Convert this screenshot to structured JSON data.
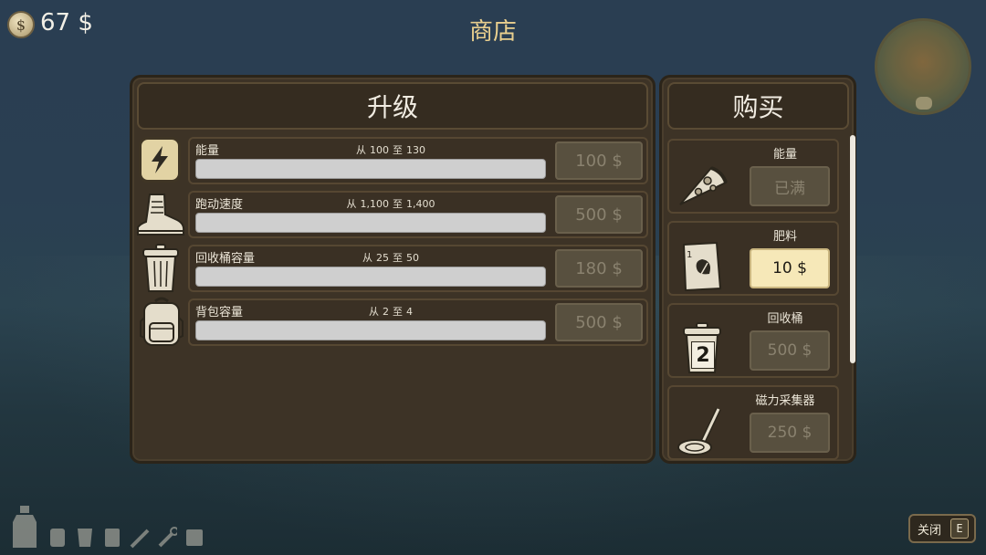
{
  "hud": {
    "currency_icon": "coin-dollar-icon",
    "money": "67 $",
    "title": "商店",
    "minimap_icon": "compass-minimap"
  },
  "upgrades": {
    "header": "升级",
    "rows": [
      {
        "icon": "lightning-icon",
        "label": "能量",
        "from_word": "从",
        "from": "100",
        "to_word": "至",
        "to": "130",
        "price": "100 $",
        "enabled": false
      },
      {
        "icon": "boot-icon",
        "label": "跑动速度",
        "from_word": "从",
        "from": "1,100",
        "to_word": "至",
        "to": "1,400",
        "price": "500 $",
        "enabled": false
      },
      {
        "icon": "trash-can-icon",
        "label": "回收桶容量",
        "from_word": "从",
        "from": "25",
        "to_word": "至",
        "to": "50",
        "price": "180 $",
        "enabled": false
      },
      {
        "icon": "backpack-icon",
        "label": "背包容量",
        "from_word": "从",
        "from": "2",
        "to_word": "至",
        "to": "4",
        "price": "500 $",
        "enabled": false
      }
    ]
  },
  "buy": {
    "header": "购买",
    "items": [
      {
        "icon": "pizza-slice-icon",
        "name": "能量",
        "button": "已满",
        "enabled": false
      },
      {
        "icon": "fertilizer-bag-icon",
        "name": "肥料",
        "button": "10 $",
        "enabled": true
      },
      {
        "icon": "trash-can-2-icon",
        "badge": "2",
        "name": "回收桶",
        "button": "500 $",
        "enabled": false
      },
      {
        "icon": "metal-detector-icon",
        "name": "磁力采集器",
        "button": "250 $",
        "enabled": false
      }
    ]
  },
  "hotbar": {
    "slots": [
      "bottle-icon",
      "jar-icon",
      "cup-icon",
      "jar-icon",
      "screwdriver-icon",
      "wrench-icon",
      "box-icon"
    ]
  },
  "close": {
    "label": "关闭",
    "key": "E"
  },
  "colors": {
    "panel_bg": "#3d3326",
    "title_gold": "#e9cf8e",
    "active_button": "#f6e8b8",
    "disabled_button": "#58503f"
  }
}
